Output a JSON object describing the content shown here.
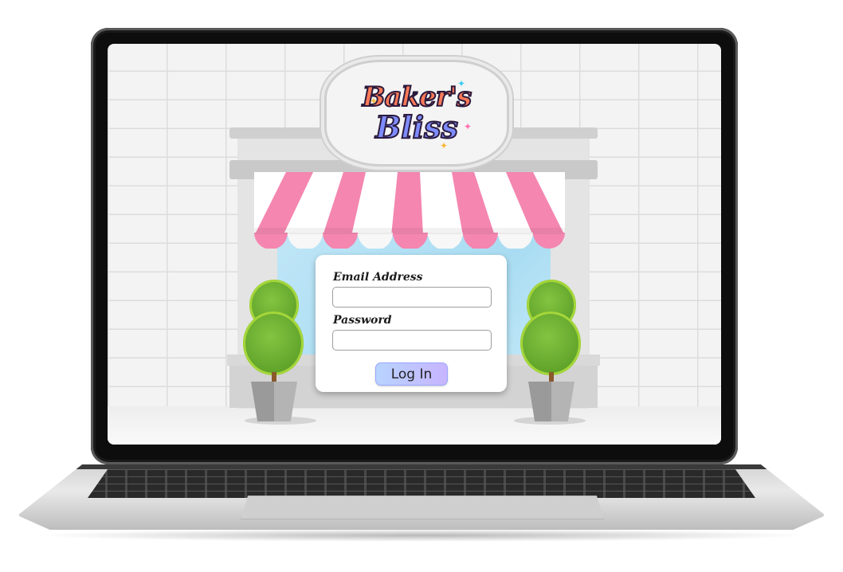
{
  "app": {
    "brand": {
      "line1": "Baker's",
      "line2": "Bliss"
    }
  },
  "login_form": {
    "email_label": "Email Address",
    "email_value": "",
    "password_label": "Password",
    "password_value": "",
    "submit_label": "Log In"
  },
  "colors": {
    "awning_pink": "#f486b0",
    "awning_white": "#ffffff",
    "window_blue": "#a9dcf2",
    "button_gradient_start": "#b8d4ff",
    "button_gradient_end": "#c7b5ff"
  }
}
